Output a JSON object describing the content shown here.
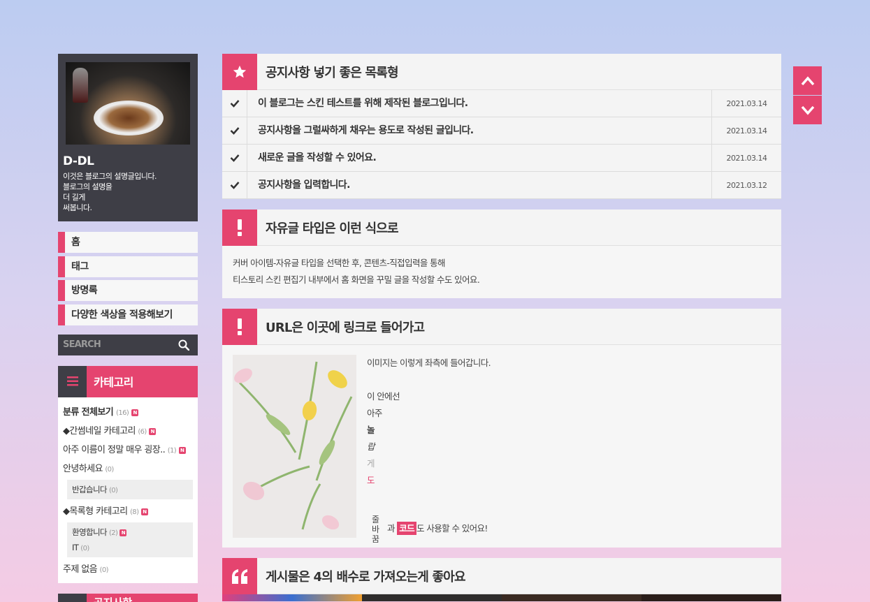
{
  "profile": {
    "name": "D-DL",
    "description": "이것은 블로그의 설명글입니다.\n블로그의 설명을\n더 길게\n써봅니다."
  },
  "nav": {
    "items": [
      {
        "label": "홈"
      },
      {
        "label": "태그"
      },
      {
        "label": "방명록"
      },
      {
        "label": "다양한 색상을 적용해보기"
      }
    ]
  },
  "search": {
    "placeholder": "SEARCH"
  },
  "category": {
    "title": "카테고리",
    "all": {
      "label": "분류 전체보기",
      "count": "(16)"
    },
    "items": [
      {
        "label": "◆간썸네일 카테고리",
        "count": "(6)",
        "new": true
      },
      {
        "label": "아주 이름이 정말 매우 굉장..",
        "count": "(1)",
        "new": true
      },
      {
        "label": "안녕하세요",
        "count": "(0)",
        "new": false
      }
    ],
    "sub1": [
      {
        "label": "반갑습니다",
        "count": "(0)"
      }
    ],
    "list_cat": {
      "label": "◆목록형 카테고리",
      "count": "(8)"
    },
    "sub2": [
      {
        "label": "환영합니다",
        "count": "(2)",
        "new": true
      },
      {
        "label": "IT",
        "count": "(0)",
        "new": false
      }
    ],
    "none": {
      "label": "주제 없음",
      "count": "(0)"
    },
    "badge": "N"
  },
  "next_box": {
    "title": "공지사항"
  },
  "notice": {
    "title": "공지사항 넣기 좋은 목록형",
    "rows": [
      {
        "title": "이 블로그는 스킨 테스트를 위해 제작된 블로그입니다.",
        "date": "2021.03.14"
      },
      {
        "title": "공지사항을 그럴싸하게 채우는 용도로 작성된 글입니다.",
        "date": "2021.03.14"
      },
      {
        "title": "새로운 글을 작성할 수 있어요.",
        "date": "2021.03.14"
      },
      {
        "title": "공지사항을 입력합니다.",
        "date": "2021.03.12"
      }
    ]
  },
  "free": {
    "title": "자유글 타입은 이런 식으로",
    "line1": "커버 아이템-자유글 타입을 선택한 후, 콘텐츠-직접입력을 통해",
    "line2": "티스토리 스킨 편집기 내부에서 홈 화면을 꾸밀 글을 작성할 수도 있어요."
  },
  "url": {
    "title": "URL은 이곳에 링크로 들어가고",
    "line1": "이미지는 이렇게 좌측에 들어갑니다.",
    "line2": "이 안에선",
    "line3": "아주",
    "line4": "놀",
    "line5": "랍",
    "line6": "게",
    "line7": "도",
    "vert1": "줄",
    "vert2": "바",
    "vert3": "꿈",
    "and": "과",
    "code": "코드",
    "tail": "도 사용할 수 있어요!"
  },
  "gallery_section": {
    "title": "게시물은 4의 배수로 가져오는게 좋아요"
  },
  "colors": {
    "accent": "#e5446f",
    "dark": "#3e3e46"
  }
}
